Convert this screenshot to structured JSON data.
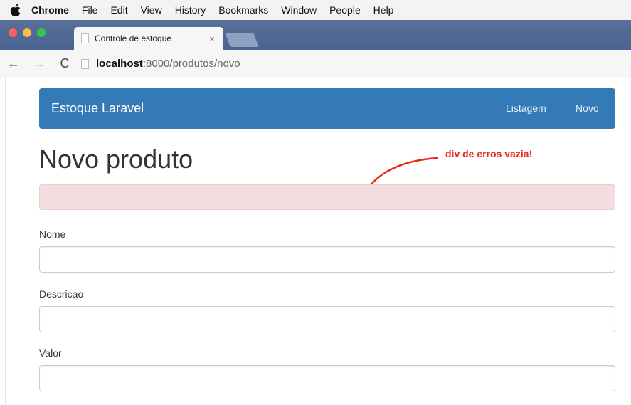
{
  "menubar": {
    "items": [
      "Chrome",
      "File",
      "Edit",
      "View",
      "History",
      "Bookmarks",
      "Window",
      "People",
      "Help"
    ]
  },
  "browser": {
    "tab_title": "Controle de estoque",
    "tab_close": "×",
    "url_host": "localhost",
    "url_path": ":8000/produtos/novo"
  },
  "navbar": {
    "brand": "Estoque Laravel",
    "links": [
      "Listagem",
      "Novo"
    ],
    "color": "#337ab7"
  },
  "page": {
    "title": "Novo produto",
    "annotation": "div de erros vazia!",
    "annotation_color": "#e62b1e",
    "error_box_color": "#f2dede"
  },
  "form": {
    "fields": [
      {
        "label": "Nome",
        "value": ""
      },
      {
        "label": "Descricao",
        "value": ""
      },
      {
        "label": "Valor",
        "value": ""
      }
    ]
  }
}
